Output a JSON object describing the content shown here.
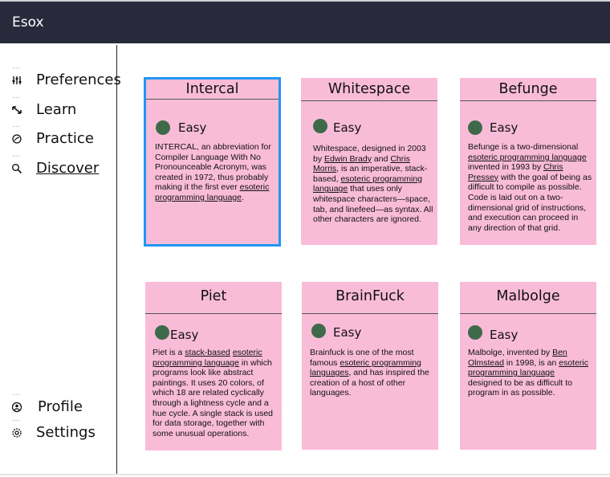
{
  "app": {
    "title": "Esox"
  },
  "sidebar": {
    "items": [
      {
        "label": "Preferences",
        "icon": "sliders-icon"
      },
      {
        "label": "Learn",
        "icon": "arrows-icon"
      },
      {
        "label": "Practice",
        "icon": "target-icon"
      },
      {
        "label": "Discover",
        "icon": "search-icon"
      }
    ],
    "bottom_items": [
      {
        "label": "Profile",
        "icon": "user-circle-icon"
      },
      {
        "label": "Settings",
        "icon": "gear-icon"
      }
    ]
  },
  "cards": [
    {
      "title": "Intercal",
      "difficulty": "Easy",
      "selected": true,
      "description": [
        {
          "t": "INTERCAL, an abbreviation for Compiler Language With No Pronounceable Acronym, was created in 1972, thus probably making it the first ever "
        },
        {
          "t": "esoteric programming language",
          "u": true
        },
        {
          "t": "."
        }
      ]
    },
    {
      "title": "Whitespace",
      "difficulty": "Easy",
      "description": [
        {
          "t": "Whitespace, designed in 2003 by "
        },
        {
          "t": "Edwin Brady",
          "u": true
        },
        {
          "t": " and "
        },
        {
          "t": "Chris Morris",
          "u": true
        },
        {
          "t": ", is an imperative, stack-based, "
        },
        {
          "t": "esoteric programming language",
          "u": true
        },
        {
          "t": " that uses only whitespace characters—space, tab, and linefeed—as syntax. All other characters are ignored."
        }
      ]
    },
    {
      "title": "Befunge",
      "difficulty": "Easy",
      "description": [
        {
          "t": "Befunge is a two-dimensional "
        },
        {
          "t": "esoteric programming language",
          "u": true
        },
        {
          "t": " invented in 1993 by "
        },
        {
          "t": "Chris Pressey",
          "u": true
        },
        {
          "t": " with the goal of being as difficult to compile as possible. Code is laid out on a two-dimensional grid of instructions, and execution can proceed in any direction of that grid."
        }
      ]
    },
    {
      "title": "Piet",
      "difficulty": "Easy",
      "description": [
        {
          "t": "Piet is a "
        },
        {
          "t": "stack-based",
          "u": true
        },
        {
          "t": " "
        },
        {
          "t": "esoteric programming language",
          "u": true
        },
        {
          "t": " in which programs look like abstract paintings. It uses 20 colors, of which 18 are related cyclically through a lightness cycle and a hue cycle. A single stack is used for data storage, together with some unusual operations."
        }
      ]
    },
    {
      "title": "BrainFuck",
      "difficulty": "Easy",
      "description": [
        {
          "t": "Brainfuck is one of the most famous "
        },
        {
          "t": "esoteric programming languages",
          "u": true
        },
        {
          "t": ", and has inspired the creation of a host of other languages."
        }
      ]
    },
    {
      "title": "Malbolge",
      "difficulty": "Easy",
      "description": [
        {
          "t": "Malbolge, invented by "
        },
        {
          "t": "Ben Olmstead",
          "u": true
        },
        {
          "t": " in 1998, is an "
        },
        {
          "t": "esoteric programming language",
          "u": true
        },
        {
          "t": " designed to be as difficult to program in as possible."
        }
      ]
    }
  ],
  "colors": {
    "topbar": "#282a3c",
    "card": "#f9bcd8",
    "selected_border": "#2196f3",
    "dot": "#3f6a4a"
  }
}
